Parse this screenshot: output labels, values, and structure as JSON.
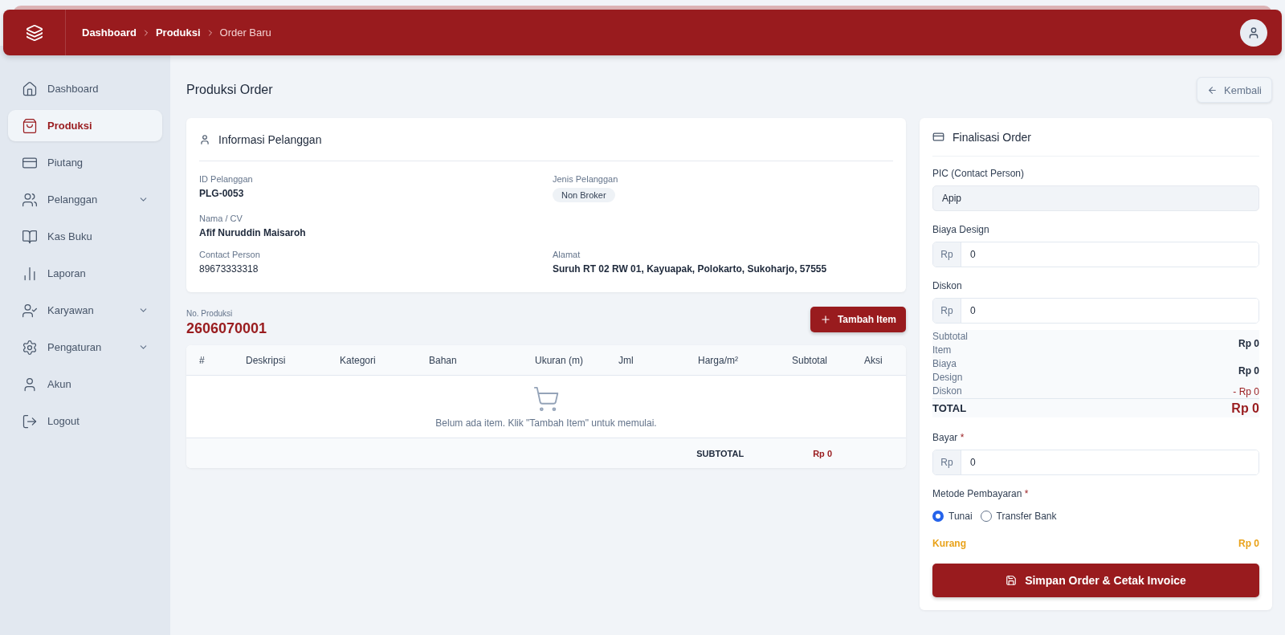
{
  "header": {
    "breadcrumbs": [
      {
        "label": "Dashboard",
        "current": false
      },
      {
        "label": "Produksi",
        "current": false
      },
      {
        "label": "Order Baru",
        "current": true
      }
    ]
  },
  "sidebar": {
    "items": [
      {
        "label": "Dashboard",
        "selected": false,
        "expandable": false
      },
      {
        "label": "Produksi",
        "selected": true,
        "expandable": false
      },
      {
        "label": "Piutang",
        "selected": false,
        "expandable": false
      },
      {
        "label": "Pelanggan",
        "selected": false,
        "expandable": true
      },
      {
        "label": "Kas Buku",
        "selected": false,
        "expandable": false
      },
      {
        "label": "Laporan",
        "selected": false,
        "expandable": false
      },
      {
        "label": "Karyawan",
        "selected": false,
        "expandable": true
      },
      {
        "label": "Pengaturan",
        "selected": false,
        "expandable": true
      },
      {
        "label": "Akun",
        "selected": false,
        "expandable": false
      },
      {
        "label": "Logout",
        "selected": false,
        "expandable": false
      }
    ]
  },
  "page": {
    "title": "Produksi Order",
    "back_button": "Kembali"
  },
  "customer": {
    "title": "Informasi Pelanggan",
    "rows": [
      [
        {
          "label": "ID Pelanggan",
          "value": "PLG-0053",
          "kind": "text"
        },
        {
          "label": "Jenis Pelanggan",
          "value": "Non Broker",
          "kind": "badge"
        }
      ],
      [
        {
          "label": "Nama / CV",
          "value": "Afif Nuruddin Maisaroh",
          "kind": "text"
        }
      ],
      [
        {
          "label": "Contact Person",
          "value": "89673333318",
          "kind": "plain"
        },
        {
          "label": "Alamat",
          "value": "Suruh RT 02 RW 01, Kayuapak, Polokarto, Sukoharjo, 57555",
          "kind": "text"
        }
      ]
    ]
  },
  "production": {
    "label": "No. Produksi",
    "number": "2606070001",
    "add_button": "Tambah Item"
  },
  "table": {
    "columns": [
      "#",
      "Deskripsi",
      "Kategori",
      "Bahan",
      "Ukuran (m)",
      "Jml",
      "Harga/m²",
      "Subtotal",
      "Aksi"
    ],
    "empty_message": "Belum ada item. Klik \"Tambah Item\" untuk memulai.",
    "footer_label": "SUBTOTAL",
    "footer_value": "Rp 0"
  },
  "finalize": {
    "title": "Finalisasi Order",
    "pic": {
      "label": "PIC (Contact Person)",
      "value": "Apip"
    },
    "fields": [
      {
        "label": "Biaya Design",
        "prefix": "Rp",
        "value": "0"
      },
      {
        "label": "Diskon",
        "prefix": "Rp",
        "value": "0"
      }
    ],
    "summary": [
      {
        "label": "Subtotal Item",
        "value": "Rp 0",
        "kind": "normal"
      },
      {
        "label": "Biaya Design",
        "value": "Rp 0",
        "kind": "normal"
      },
      {
        "label": "Diskon",
        "value": "- Rp 0",
        "kind": "discount"
      }
    ],
    "total": {
      "label": "TOTAL",
      "value": "Rp 0"
    },
    "pay": {
      "label": "Bayar",
      "required_mark": "*",
      "prefix": "Rp",
      "value": "0"
    },
    "method": {
      "label": "Metode Pembayaran",
      "required_mark": "*",
      "options": [
        {
          "label": "Tunai",
          "selected": true
        },
        {
          "label": "Transfer Bank",
          "selected": false
        }
      ]
    },
    "shortfall": {
      "label": "Kurang",
      "value": "Rp 0"
    },
    "submit_button": "Simpan Order & Cetak Invoice"
  }
}
